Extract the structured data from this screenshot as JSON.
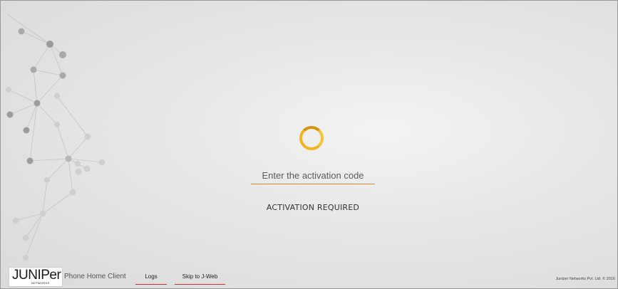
{
  "main": {
    "activation_placeholder": "Enter the activation code",
    "activation_value": "",
    "status_text": "ACTIVATION REQUIRED"
  },
  "footer": {
    "logo_text": "JUNIPer",
    "logo_subtext": "NETWORKS",
    "app_name": "Phone Home Client",
    "links": [
      {
        "label": "Logs"
      },
      {
        "label": "Skip to J-Web"
      }
    ],
    "copyright": "Juniper Networks Pvt. Ltd. © 2016"
  },
  "colors": {
    "spinner": "#f1b51f",
    "input_underline": "#c9893a",
    "link_underline": "#c0392b"
  },
  "icons": {
    "spinner": "loading-spinner-icon",
    "background": "network-nodes-graphic"
  }
}
